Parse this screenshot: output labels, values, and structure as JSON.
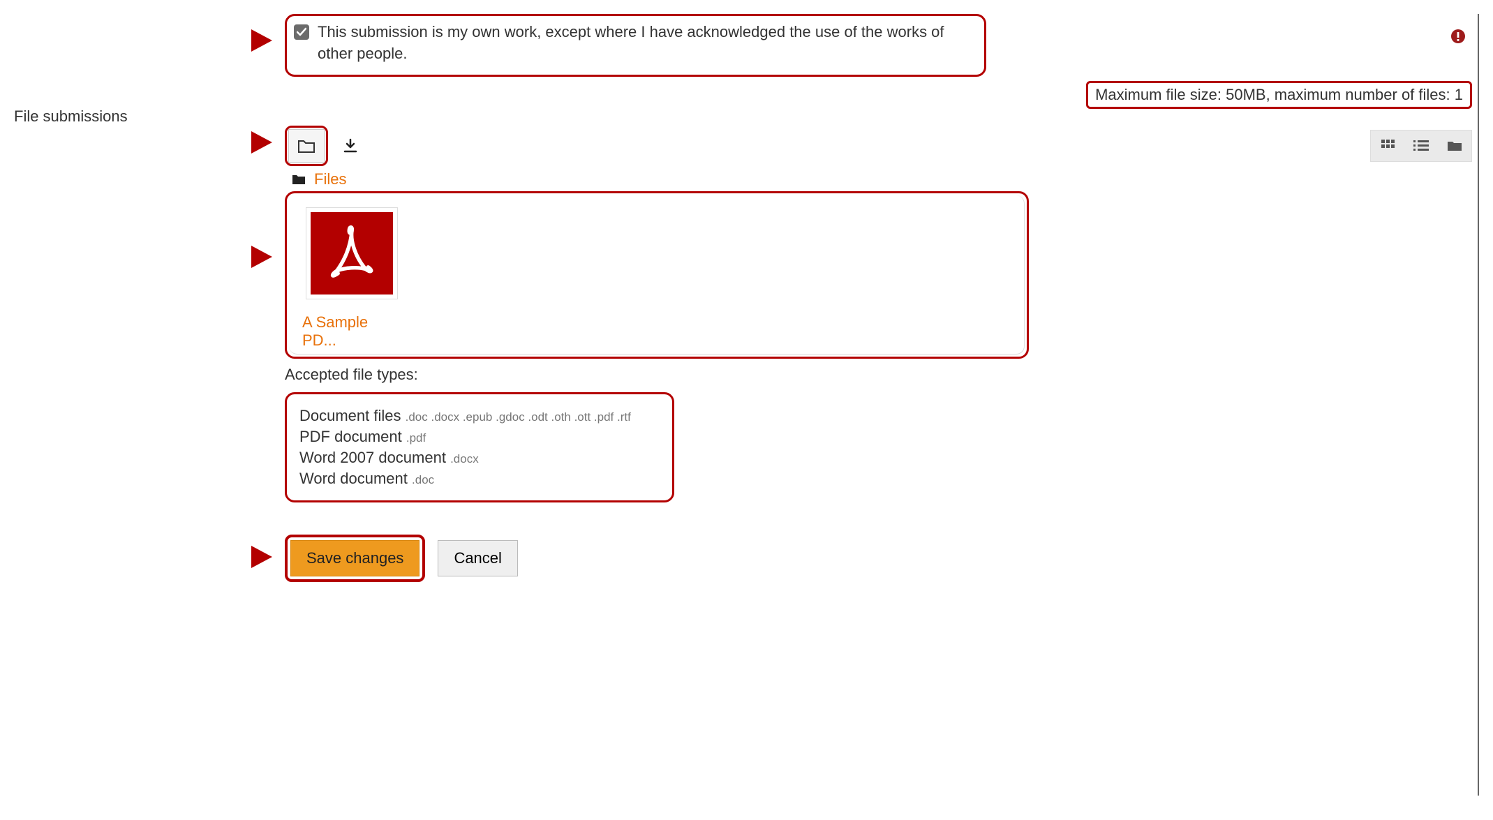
{
  "declaration": {
    "text": "This submission is my own work, except where I have acknowledged the use of the works of other people.",
    "checked": true
  },
  "section_label": "File submissions",
  "limits_text": "Maximum file size: 50MB, maximum number of files: 1",
  "breadcrumb": {
    "label": "Files"
  },
  "file": {
    "display_name": "A Sample PD..."
  },
  "accepted_label": "Accepted file types:",
  "filetypes": [
    {
      "label": "Document files",
      "exts": ".doc .docx .epub .gdoc .odt .oth .ott .pdf .rtf"
    },
    {
      "label": "PDF document",
      "exts": ".pdf"
    },
    {
      "label": "Word 2007 document",
      "exts": ".docx"
    },
    {
      "label": "Word document",
      "exts": ".doc"
    }
  ],
  "buttons": {
    "save": "Save changes",
    "cancel": "Cancel"
  }
}
